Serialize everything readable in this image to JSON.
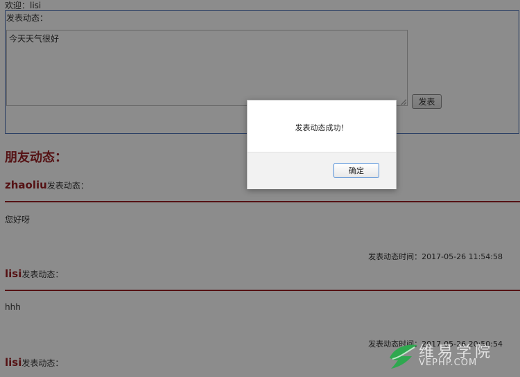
{
  "welcome": {
    "text": "欢迎：lisi"
  },
  "post": {
    "label": "发表动态：",
    "textarea_value": "今天天气很好",
    "button_label": "发表"
  },
  "friends": {
    "title": "朋友动态：",
    "feeds": [
      {
        "user": "zhaoliu",
        "suffix": "发表动态：",
        "content": "您好呀",
        "time": "发表动态时间：2017-05-26 11:54:58"
      },
      {
        "user": "lisi",
        "suffix": "发表动态：",
        "content": "hhh",
        "time": "发表动态时间：2017-05-26 20:50:54"
      },
      {
        "user": "lisi",
        "suffix": "发表动态："
      }
    ]
  },
  "dialog": {
    "message": "发表动态成功！",
    "ok_label": "确定"
  },
  "watermark": {
    "cn": "维易学院",
    "en": "VEPHP.COM"
  },
  "colors": {
    "accent": "#9b2226",
    "dialog_button_border": "#4b8ad6",
    "post_box_border": "#4a6fb5"
  }
}
